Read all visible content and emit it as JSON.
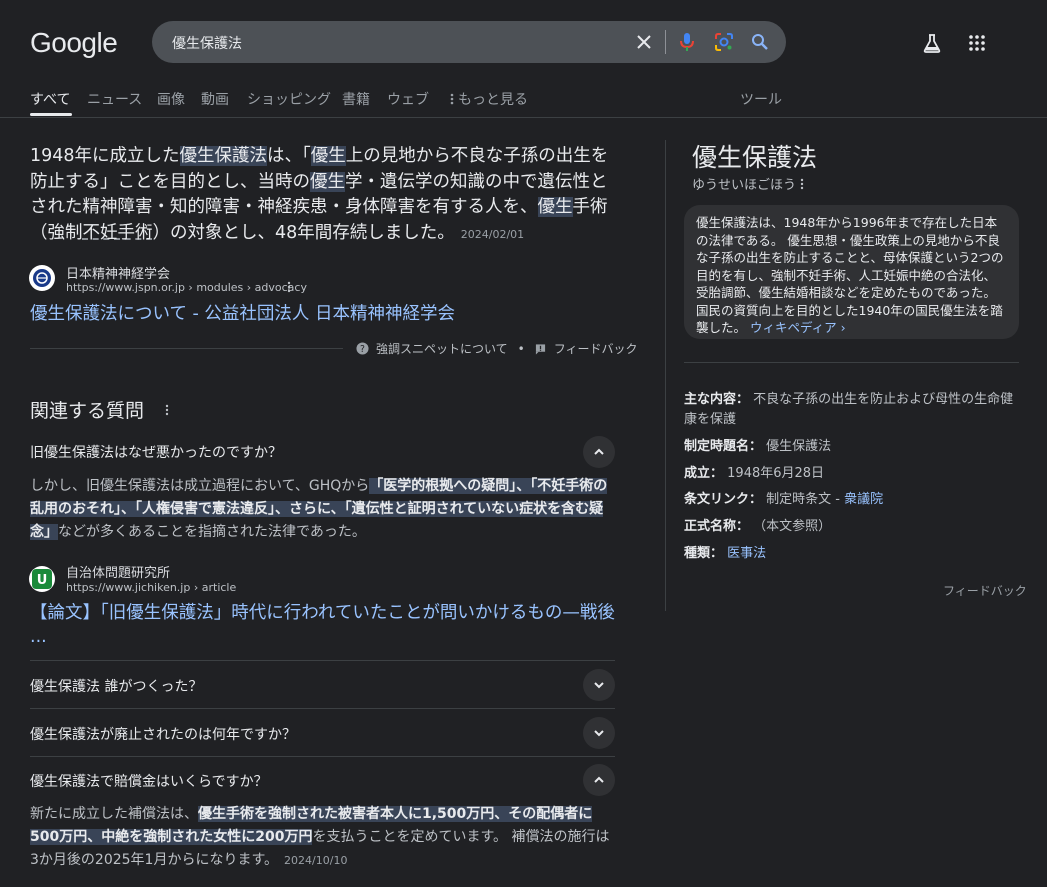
{
  "header": {
    "logo": "Google",
    "search_query": "優生保護法"
  },
  "icons": [
    "close-icon",
    "mic-icon",
    "lens-icon",
    "search-icon",
    "labs-flask-icon",
    "apps-grid-icon",
    "more-vert-icon",
    "help-icon",
    "feedback-flag-icon",
    "chevron-up-icon",
    "chevron-down-icon"
  ],
  "tabs": [
    {
      "label": "すべて",
      "active": true
    },
    {
      "label": "ニュース"
    },
    {
      "label": "画像"
    },
    {
      "label": "動画"
    },
    {
      "label": "ショッピング"
    },
    {
      "label": "書籍"
    },
    {
      "label": "ウェブ"
    },
    {
      "label": "もっと見る"
    },
    {
      "label": "ツール"
    }
  ],
  "snippet": {
    "seg1": "1948年に成立した",
    "hl1": "優生保護法",
    "seg2": "は、「",
    "hl2": "優生",
    "seg3": "上の見地から不良な子孫の出生を防止する」ことを目的とし、当時の",
    "hl3": "優生",
    "seg4": "学・遺伝学の知識の中で遺伝性とされた精神障害・知的障害・神経疾患・身体障害を有する人を、",
    "hl4": "優生",
    "seg5": "手術（強制",
    "seg6": "不妊手術",
    "seg7": "）の対象とし、48年間存続しました。",
    "date": "2024/02/01",
    "source_name": "日本精神神経学会",
    "source_url": "https://www.jspn.or.jp › modules › advocacy",
    "title": "優生保護法について - 公益社団法人 日本精神神経学会",
    "about": "強調スニペットについて",
    "dot": "•",
    "feedback": "フィードバック"
  },
  "paa": {
    "title": "関連する質問",
    "q1": "旧優生保護法はなぜ悪かったのですか？",
    "a1_seg1": "しかし、旧優生保護法は成立過程において、GHQから",
    "a1_hl": "「医学的根拠への疑問」、「不妊手術の乱用のおそれ」、「人権侵害で憲法違反」、さらに、「遺伝性と証明されていない症状を含む疑念」",
    "a1_seg2": "などが多くあることを指摘された法律であった。",
    "a1_source": "自治体問題研究所",
    "a1_url": "https://www.jichiken.jp › article",
    "a1_title": "【論文】「旧優生保護法」時代に行われていたことが問いかけるもの—戦後 ...",
    "q2": "優生保護法 誰がつくった？",
    "q3": "優生保護法が廃止されたのは何年ですか？",
    "q4": "優生保護法で賠償金はいくらですか？",
    "a4_hl": "優生手術を強制された被害者本人に1,500万円、その配偶者に500万円、中絶を強制された女性に200万円",
    "a4_seg1": "新たに成立した補償法は、",
    "a4_seg2": "を支払うことを定めています。 補償法の施行は3か月後の2025年1月からになります。",
    "a4_date": "2024/10/10"
  },
  "kp": {
    "title": "優生保護法",
    "reading": "ゆうせいほごほう",
    "desc": "優生保護法は、1948年から1996年まで存在した日本の法律である。 優生思想・優生政策上の見地から不良な子孫の出生を防止することと、母体保護という2つの目的を有し、強制不妊手術、人工妊娠中絶の合法化、受胎調節、優生結婚相談などを定めたものであった。国民の資質向上を目的とした1940年の国民優生法を踏襲した。",
    "wiki": "ウィキペディア ›",
    "facts": [
      {
        "label": "主な内容：",
        "value": "不良な子孫の出生を防止および母性の生命健康を保護"
      },
      {
        "label": "制定時題名：",
        "value": "優生保護法"
      },
      {
        "label": "成立：",
        "value": "1948年6月28日"
      },
      {
        "label": "条文リンク：",
        "value": "制定時条文 - ",
        "link": "衆議院"
      },
      {
        "label": "正式名称：",
        "value": "（本文参照）"
      },
      {
        "label": "種類：",
        "link": "医事法"
      }
    ],
    "feedback": "フィードバック"
  }
}
